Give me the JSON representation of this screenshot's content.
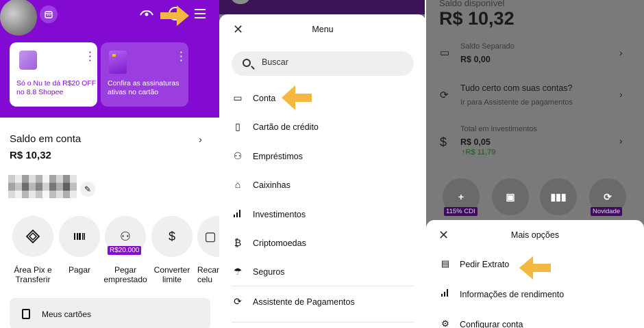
{
  "colors": {
    "brand": "#820ad1",
    "brand_light": "#9b3ee0",
    "arrow": "#f4b73f",
    "overlay": "#747474"
  },
  "home": {
    "promos": [
      {
        "text": "Só o Nu te dá R$20 OFF no 8.8 Shopee",
        "icon": "shopping-bag-icon"
      },
      {
        "text": "Confira as assinaturas ativas no cartão",
        "icon": "card-icon"
      }
    ],
    "balance_title": "Saldo em conta",
    "balance_value": "R$ 10,32",
    "actions": [
      {
        "label": "Área Pix e Transferir",
        "icon": "pix-icon"
      },
      {
        "label": "Pagar",
        "icon": "barcode-icon"
      },
      {
        "label": "Pegar emprestado",
        "icon": "loan-icon",
        "badge": "R$20.000"
      },
      {
        "label": "Converter limite",
        "icon": "dollar-icon"
      },
      {
        "label": "Recarga celu",
        "icon": "phone-icon"
      }
    ],
    "cards_label": "Meus cartões"
  },
  "menu": {
    "title": "Menu",
    "search_placeholder": "Buscar",
    "items": [
      {
        "label": "Conta",
        "icon": "account-icon"
      },
      {
        "label": "Cartão de crédito",
        "icon": "credit-card-icon"
      },
      {
        "label": "Empréstimos",
        "icon": "loan-icon"
      },
      {
        "label": "Caixinhas",
        "icon": "savings-box-icon"
      },
      {
        "label": "Investimentos",
        "icon": "investments-icon"
      },
      {
        "label": "Criptomoedas",
        "icon": "bitcoin-icon"
      },
      {
        "label": "Seguros",
        "icon": "umbrella-icon"
      },
      {
        "label": "Assistente de Pagamentos",
        "icon": "payments-assistant-icon"
      }
    ]
  },
  "account": {
    "available_label": "Saldo disponível",
    "available_value": "R$ 10,32",
    "separated_label": "Saldo Separado",
    "separated_value": "R$ 0,00",
    "accounts_title": "Tudo certo com suas contas?",
    "accounts_sub": "Ir para Assistente de pagamentos",
    "invest_label": "Total em investimentos",
    "invest_value": "R$ 0,05",
    "invest_gain": "R$ 11,79",
    "action_badges": [
      "115% CDI",
      "Novidade"
    ],
    "options_sheet": {
      "title": "Mais opções",
      "options": [
        {
          "label": "Pedir Extrato",
          "icon": "document-icon"
        },
        {
          "label": "Informações de rendimento",
          "icon": "bar-signal-icon"
        },
        {
          "label": "Configurar conta",
          "icon": "settings-icon"
        }
      ]
    }
  }
}
